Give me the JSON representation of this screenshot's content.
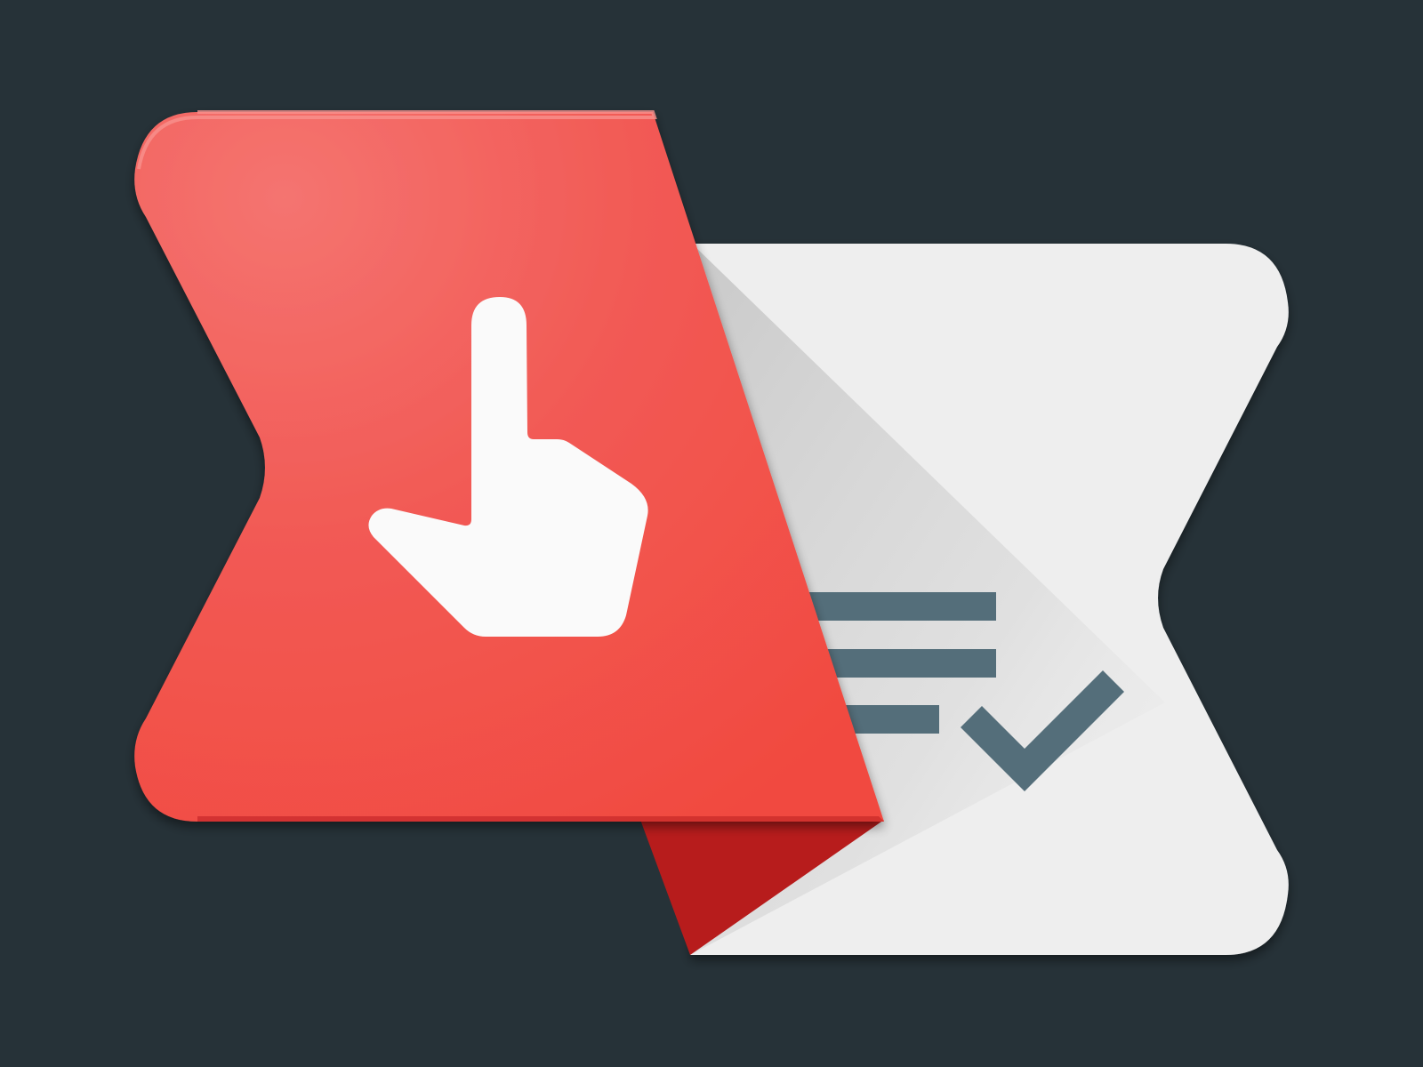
{
  "logo": {
    "name": "task-list-check-logo",
    "icons": {
      "primary": "pointing-hand-icon",
      "secondary": "checklist-icon"
    },
    "colors": {
      "background": "#263238",
      "red_top": "#F47470",
      "red_mid": "#F25A55",
      "red_bottom": "#F14A40",
      "red_dark": "#B71C1C",
      "red_edge": "#C62828",
      "white_panel": "#EEEEEE",
      "panel_shadow": "#CFCFCF",
      "hand": "#FAFAFA",
      "lines": "#546E7A"
    }
  }
}
